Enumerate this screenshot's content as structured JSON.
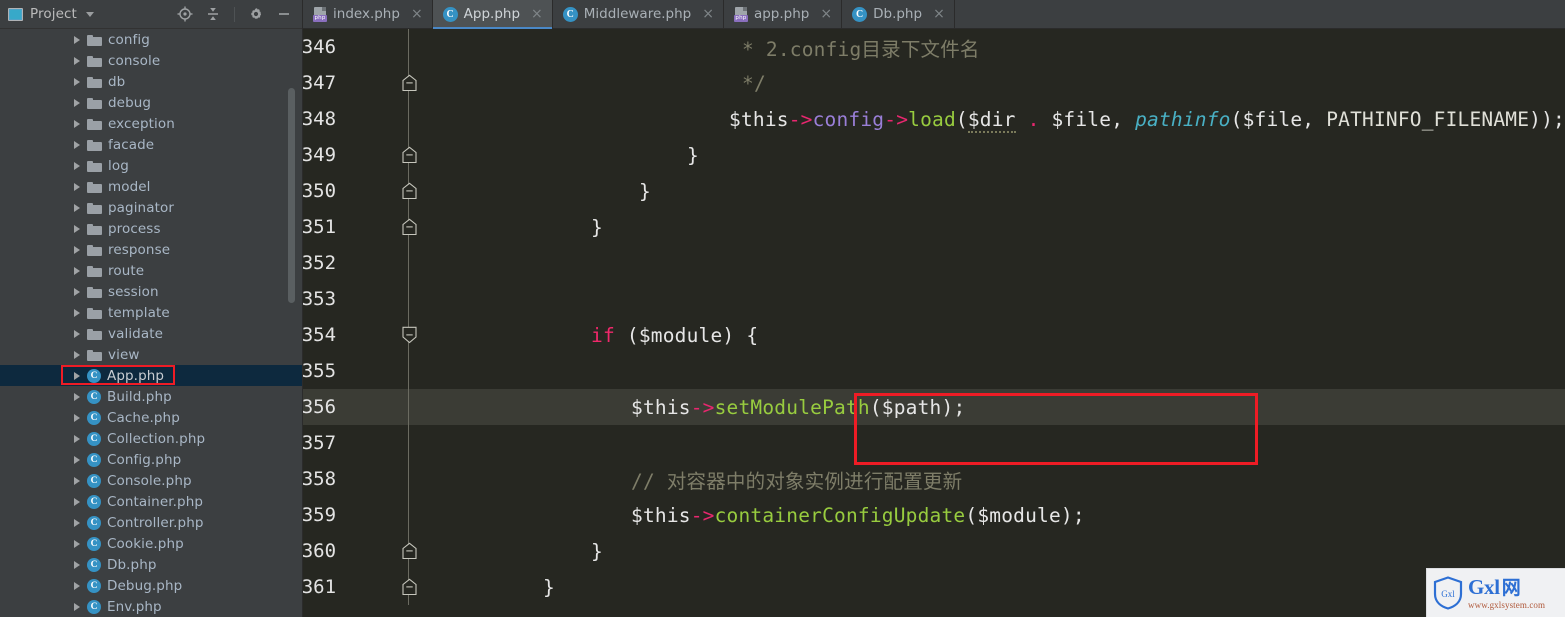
{
  "sidebar": {
    "panel_title": "Project",
    "tools": [
      {
        "name": "locate-target-icon",
        "label": "Select Opened File"
      },
      {
        "name": "collapse-all-icon",
        "label": "Collapse All"
      },
      {
        "name": "gear-icon",
        "label": "Settings"
      },
      {
        "name": "minimize-icon",
        "label": "Hide"
      }
    ],
    "tree": [
      {
        "label": "config",
        "kind": "folder",
        "selected": false
      },
      {
        "label": "console",
        "kind": "folder",
        "selected": false
      },
      {
        "label": "db",
        "kind": "folder",
        "selected": false
      },
      {
        "label": "debug",
        "kind": "folder",
        "selected": false
      },
      {
        "label": "exception",
        "kind": "folder",
        "selected": false
      },
      {
        "label": "facade",
        "kind": "folder",
        "selected": false
      },
      {
        "label": "log",
        "kind": "folder",
        "selected": false
      },
      {
        "label": "model",
        "kind": "folder",
        "selected": false
      },
      {
        "label": "paginator",
        "kind": "folder",
        "selected": false
      },
      {
        "label": "process",
        "kind": "folder",
        "selected": false
      },
      {
        "label": "response",
        "kind": "folder",
        "selected": false
      },
      {
        "label": "route",
        "kind": "folder",
        "selected": false
      },
      {
        "label": "session",
        "kind": "folder",
        "selected": false
      },
      {
        "label": "template",
        "kind": "folder",
        "selected": false
      },
      {
        "label": "validate",
        "kind": "folder",
        "selected": false
      },
      {
        "label": "view",
        "kind": "folder",
        "selected": false
      },
      {
        "label": "App.php",
        "kind": "class",
        "selected": true
      },
      {
        "label": "Build.php",
        "kind": "class",
        "selected": false
      },
      {
        "label": "Cache.php",
        "kind": "class",
        "selected": false
      },
      {
        "label": "Collection.php",
        "kind": "class",
        "selected": false
      },
      {
        "label": "Config.php",
        "kind": "class",
        "selected": false
      },
      {
        "label": "Console.php",
        "kind": "class",
        "selected": false
      },
      {
        "label": "Container.php",
        "kind": "class",
        "selected": false
      },
      {
        "label": "Controller.php",
        "kind": "class",
        "selected": false
      },
      {
        "label": "Cookie.php",
        "kind": "class",
        "selected": false
      },
      {
        "label": "Db.php",
        "kind": "class",
        "selected": false
      },
      {
        "label": "Debug.php",
        "kind": "class",
        "selected": false
      },
      {
        "label": "Env.php",
        "kind": "class",
        "selected": false
      }
    ],
    "class_badge": "C"
  },
  "tabs": [
    {
      "label": "index.php",
      "icon": "php-file-icon",
      "active": false,
      "close": "×"
    },
    {
      "label": "App.php",
      "icon": "php-class-icon",
      "active": true,
      "close": "×"
    },
    {
      "label": "Middleware.php",
      "icon": "php-class-icon",
      "active": false,
      "close": "×"
    },
    {
      "label": "app.php",
      "icon": "php-file-icon",
      "active": false,
      "close": "×"
    },
    {
      "label": "Db.php",
      "icon": "php-class-icon",
      "active": false,
      "close": "×"
    }
  ],
  "tab_icon_text": {
    "php": "php",
    "class": "C"
  },
  "editor": {
    "lines": [
      {
        "num": "346",
        "fold": "none",
        "current": false
      },
      {
        "num": "347",
        "fold": "up",
        "current": false
      },
      {
        "num": "348",
        "fold": "none",
        "current": false
      },
      {
        "num": "349",
        "fold": "up",
        "current": false
      },
      {
        "num": "350",
        "fold": "up",
        "current": false
      },
      {
        "num": "351",
        "fold": "up",
        "current": false
      },
      {
        "num": "352",
        "fold": "none",
        "current": false
      },
      {
        "num": "353",
        "fold": "none",
        "current": false
      },
      {
        "num": "354",
        "fold": "down",
        "current": false
      },
      {
        "num": "355",
        "fold": "none",
        "current": false
      },
      {
        "num": "356",
        "fold": "none",
        "current": true
      },
      {
        "num": "357",
        "fold": "none",
        "current": false
      },
      {
        "num": "358",
        "fold": "none",
        "current": false
      },
      {
        "num": "359",
        "fold": "none",
        "current": false
      },
      {
        "num": "360",
        "fold": "up",
        "current": false
      },
      {
        "num": "361",
        "fold": "up",
        "current": false
      }
    ],
    "code": {
      "l346": "             * 2.config目录下文件名",
      "l347": "             */",
      "l348_full": "            $this->config->load($dir . $file, pathinfo($file, PATHINFO_FILENAME));",
      "l349": "          }",
      "l350": "        }",
      "l351": "      }",
      "l352": "",
      "l353": "",
      "l354_full": "      if ($module) {",
      "l355": "",
      "l356_full": "          $this->setModulePath($path);",
      "l357": "",
      "l358": "          // 对容器中的对象实例进行配置更新",
      "l359_full": "          $this->containerConfigUpdate($module);",
      "l360": "        }",
      "l361": "      }"
    },
    "tokens": {
      "this": "$this",
      "arrow": "->",
      "config": "config",
      "load": "load",
      "dir": "$dir",
      "dot": ".",
      "file": "$file",
      "pathinfo": "pathinfo",
      "pathinfo_filename": "PATHINFO_FILENAME",
      "if": "if",
      "module": "$module",
      "setModulePath": "setModulePath",
      "path": "$path",
      "containerConfigUpdate": "containerConfigUpdate",
      "comment346": "* 2.config目录下文件名",
      "comment347": "*/",
      "comment358": "// 对容器中的对象实例进行配置更新",
      "brace_close": "}",
      "brace_open": "{",
      "paren_open": "(",
      "paren_close": ")",
      "semi": ";",
      "comma": ","
    }
  },
  "annotations": [
    {
      "name": "annotation-tree-appphp",
      "color": "#ee1c25"
    },
    {
      "name": "annotation-line-356",
      "color": "#ee1c25"
    }
  ],
  "watermark": {
    "shield_text": "Gxl",
    "brand": "Gxl",
    "brand_cn": "网",
    "url": "www.gxlsystem.com"
  },
  "colors": {
    "editor_bg": "#262721",
    "current_line_bg": "#3b3c35",
    "sidebar_bg": "#3c3f41",
    "selection_bg": "#0d293e",
    "accent_tab": "#4a88c7",
    "annotation": "#ee1c25",
    "class_icon": "#3592c4"
  }
}
